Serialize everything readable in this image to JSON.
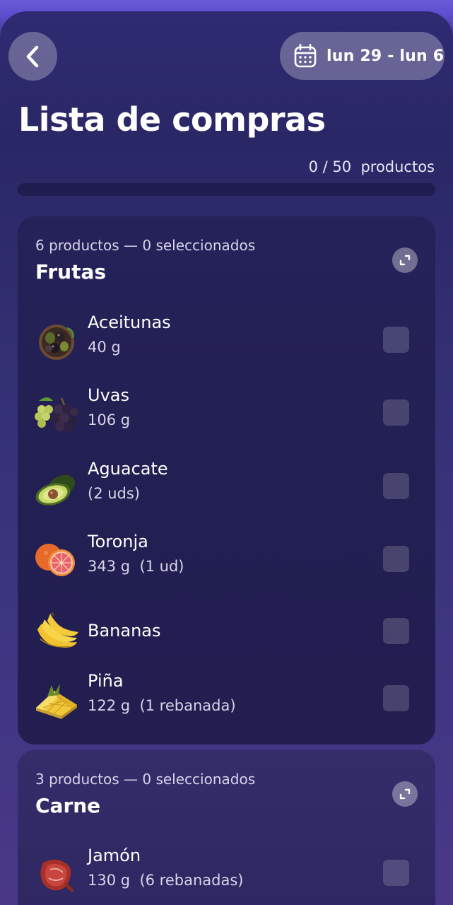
{
  "header": {
    "date_range": "lun 29 - lun 6",
    "title": "Lista de compras",
    "progress_count": "0 / 50",
    "progress_unit": "productos",
    "progress_fraction": 0
  },
  "categories": [
    {
      "meta": "6 productos — 0 seleccionados",
      "title": "Frutas",
      "items": [
        {
          "name": "Aceitunas",
          "qty": "40 g",
          "icon": "olives-icon"
        },
        {
          "name": "Uvas",
          "qty": "106 g",
          "icon": "grapes-icon"
        },
        {
          "name": "Aguacate",
          "qty": "(2 uds)",
          "icon": "avocado-icon"
        },
        {
          "name": "Toronja",
          "qty": "343 g  (1 ud)",
          "icon": "grapefruit-icon"
        },
        {
          "name": "Bananas",
          "qty": "",
          "icon": "bananas-icon"
        },
        {
          "name": "Piña",
          "qty": "122 g  (1 rebanada)",
          "icon": "pineapple-icon"
        }
      ]
    },
    {
      "meta": "3 productos — 0 seleccionados",
      "title": "Carne",
      "items": [
        {
          "name": "Jamón",
          "qty": "130 g  (6 rebanadas)",
          "icon": "ham-icon"
        }
      ]
    }
  ],
  "colors": {
    "accent": "#8e7cf2",
    "background_top": "#6a5ad8",
    "card": "#25225a"
  }
}
